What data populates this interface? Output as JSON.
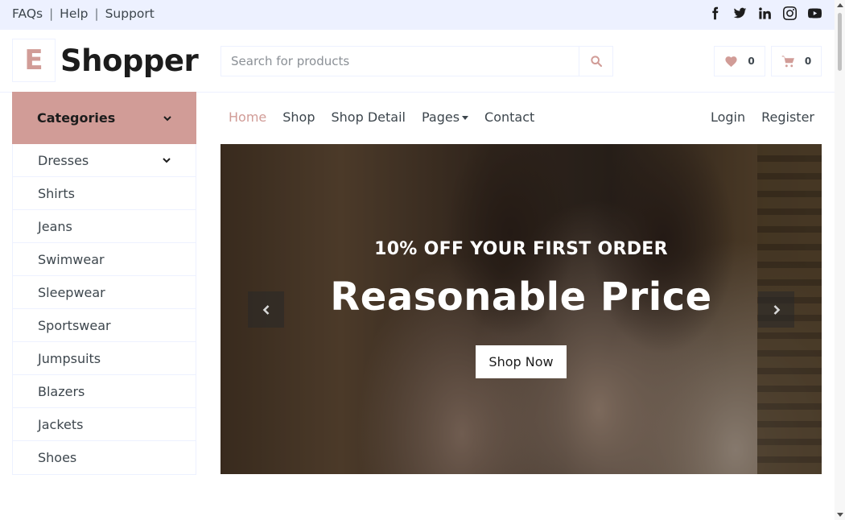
{
  "topbar": {
    "links": [
      "FAQs",
      "Help",
      "Support"
    ],
    "separator": "|",
    "social_icons": [
      "facebook-icon",
      "twitter-icon",
      "linkedin-icon",
      "instagram-icon",
      "youtube-icon"
    ]
  },
  "header": {
    "logo_letter": "E",
    "logo_text": "Shopper",
    "search_placeholder": "Search for products",
    "wishlist_count": "0",
    "cart_count": "0"
  },
  "sidebar": {
    "title": "Categories",
    "items": [
      {
        "label": "Dresses",
        "has_submenu": true
      },
      {
        "label": "Shirts"
      },
      {
        "label": "Jeans"
      },
      {
        "label": "Swimwear"
      },
      {
        "label": "Sleepwear"
      },
      {
        "label": "Sportswear"
      },
      {
        "label": "Jumpsuits"
      },
      {
        "label": "Blazers"
      },
      {
        "label": "Jackets"
      },
      {
        "label": "Shoes"
      }
    ]
  },
  "nav": {
    "items": [
      {
        "label": "Home",
        "active": true
      },
      {
        "label": "Shop"
      },
      {
        "label": "Shop Detail"
      },
      {
        "label": "Pages",
        "dropdown": true
      },
      {
        "label": "Contact"
      }
    ],
    "right": [
      {
        "label": "Login"
      },
      {
        "label": "Register"
      }
    ]
  },
  "hero": {
    "subtitle": "10% OFF YOUR FIRST ORDER",
    "title": "Reasonable Price",
    "button": "Shop Now"
  },
  "colors": {
    "accent": "#d19c97",
    "topbar_bg": "#edf1ff",
    "text": "#3d464d",
    "dark": "#1c1c1c"
  }
}
